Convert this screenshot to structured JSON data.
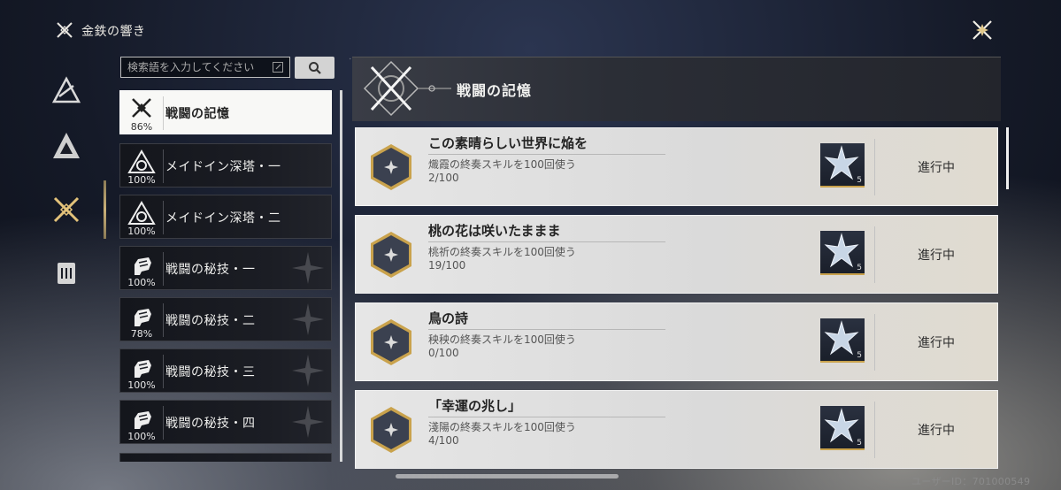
{
  "app": {
    "title": "金鉄の響き"
  },
  "search": {
    "placeholder": "検索語を入力してください"
  },
  "categories": [
    {
      "label": "戦闘の記憶",
      "pct": "86%",
      "icon": "crossed-swords-icon",
      "active": true
    },
    {
      "label": "メイドイン深塔・一",
      "pct": "100%",
      "icon": "tower-emblem-icon",
      "active": false
    },
    {
      "label": "メイドイン深塔・二",
      "pct": "100%",
      "icon": "tower-emblem-icon",
      "active": false
    },
    {
      "label": "戦闘の秘技・一",
      "pct": "100%",
      "icon": "fist-icon",
      "active": false
    },
    {
      "label": "戦闘の秘技・二",
      "pct": "78%",
      "icon": "fist-icon",
      "active": false
    },
    {
      "label": "戦闘の秘技・三",
      "pct": "100%",
      "icon": "fist-icon",
      "active": false
    },
    {
      "label": "戦闘の秘技・四",
      "pct": "100%",
      "icon": "fist-icon",
      "active": false
    }
  ],
  "header": {
    "title": "戦闘の記憶"
  },
  "achievements": [
    {
      "title": "この素晴らしい世界に焔を",
      "desc": "熾霞の終奏スキルを100回使う",
      "progress": "2/100",
      "reward_count": "5",
      "status": "進行中"
    },
    {
      "title": "桃の花は咲いたままま",
      "desc": "桃祈の終奏スキルを100回使う",
      "progress": "19/100",
      "reward_count": "5",
      "status": "進行中"
    },
    {
      "title": "鳥の詩",
      "desc": "秧秧の終奏スキルを100回使う",
      "progress": "0/100",
      "reward_count": "5",
      "status": "進行中"
    },
    {
      "title": "「幸運の兆し」",
      "desc": "淺陽の終奏スキルを100回使う",
      "progress": "4/100",
      "reward_count": "5",
      "status": "進行中"
    }
  ],
  "footer": {
    "user_id": "ユーザーID：701000549"
  },
  "colors": {
    "accent_gold": "#c9a24c",
    "active_bg": "#f8f8f6",
    "card_bg": "#e0e0e0"
  }
}
